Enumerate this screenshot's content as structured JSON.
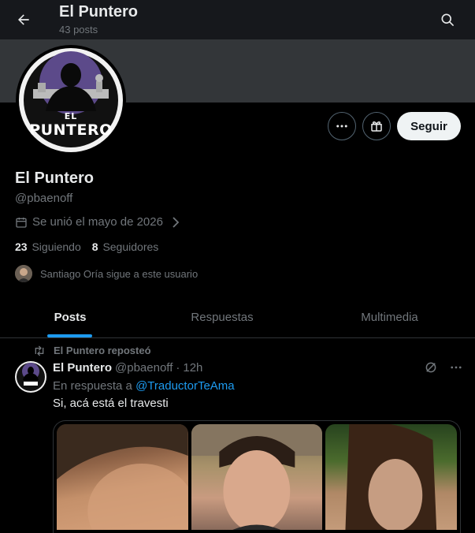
{
  "header": {
    "title": "El Puntero",
    "subtitle": "43 posts"
  },
  "profile": {
    "name": "El Puntero",
    "handle": "@pbaenoff",
    "joined": "Se unió el mayo de 2026",
    "following_count": "23",
    "following_label": "Siguiendo",
    "followers_count": "8",
    "followers_label": "Seguidores",
    "followed_by": "Santiago Oría sigue a este usuario",
    "avatar_text_top": "EL",
    "avatar_text_bottom": "PUNTERO"
  },
  "actions": {
    "follow_label": "Seguir"
  },
  "tabs": [
    {
      "label": "Posts",
      "active": true
    },
    {
      "label": "Respuestas"
    },
    {
      "label": "Multimedia"
    }
  ],
  "post": {
    "repost_label": "El Puntero reposteó",
    "author_name": "El Puntero",
    "author_handle": "@pbaenoff",
    "separator": "·",
    "time": "12h",
    "reply_prefix": "En respuesta a",
    "reply_to": "@TraductorTeAma",
    "text": "Si, acá está el travesti"
  },
  "colors": {
    "background": "#000000",
    "header": "#16181c",
    "banner": "#333639",
    "accent": "#1d9bf0",
    "muted_text": "#71767b",
    "avatar_purple": "#5c4a8a"
  },
  "icons": [
    "back-arrow-icon",
    "search-icon",
    "more-icon",
    "gift-icon",
    "calendar-icon",
    "chevron-right-icon",
    "repost-icon",
    "grok-icon"
  ]
}
